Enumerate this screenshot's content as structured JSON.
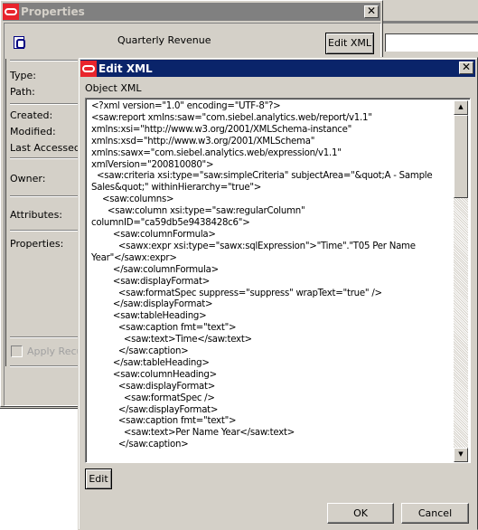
{
  "properties_window": {
    "title": "Properties",
    "object_name": "Quarterly Revenue",
    "edit_xml_label": "Edit XML",
    "close_label": "✕",
    "labels": {
      "type": "Type:",
      "path": "Path:",
      "created": "Created:",
      "modified": "Modified:",
      "last_accessed": "Last Accessed:",
      "owner": "Owner:",
      "attributes": "Attributes:",
      "properties": "Properties:"
    },
    "apply_recursive_label": "Apply Recur",
    "apply_recursive_checked": false
  },
  "edit_xml_dialog": {
    "title": "Edit XML",
    "close_label": "✕",
    "object_xml_label": "Object XML",
    "xml_lines": [
      "<?xml version=\"1.0\" encoding=\"UTF-8\"?>",
      "<saw:report xmlns:saw=\"com.siebel.analytics.web/report/v1.1\"",
      "xmlns:xsi=\"http://www.w3.org/2001/XMLSchema-instance\"",
      "xmlns:xsd=\"http://www.w3.org/2001/XMLSchema\"",
      "xmlns:sawx=\"com.siebel.analytics.web/expression/v1.1\"",
      "xmlVersion=\"200810080\">",
      "  <saw:criteria xsi:type=\"saw:simpleCriteria\" subjectArea=\"&quot;A - Sample",
      "Sales&quot;\" withinHierarchy=\"true\">",
      "    <saw:columns>",
      "      <saw:column xsi:type=\"saw:regularColumn\"",
      "columnID=\"ca59db5e9438428c6\">",
      "        <saw:columnFormula>",
      "          <sawx:expr xsi:type=\"sawx:sqlExpression\">\"Time\".\"T05 Per Name",
      "Year\"</sawx:expr>",
      "        </saw:columnFormula>",
      "        <saw:displayFormat>",
      "          <saw:formatSpec suppress=\"suppress\" wrapText=\"true\" />",
      "        </saw:displayFormat>",
      "        <saw:tableHeading>",
      "          <saw:caption fmt=\"text\">",
      "            <saw:text>Time</saw:text>",
      "          </saw:caption>",
      "        </saw:tableHeading>",
      "        <saw:columnHeading>",
      "          <saw:displayFormat>",
      "            <saw:formatSpec />",
      "          </saw:displayFormat>",
      "          <saw:caption fmt=\"text\">",
      "            <saw:text>Per Name Year</saw:text>",
      "          </saw:caption>"
    ],
    "edit_label": "Edit",
    "ok_label": "OK",
    "cancel_label": "Cancel",
    "scroll_up_icon": "▲",
    "scroll_down_icon": "▼"
  }
}
